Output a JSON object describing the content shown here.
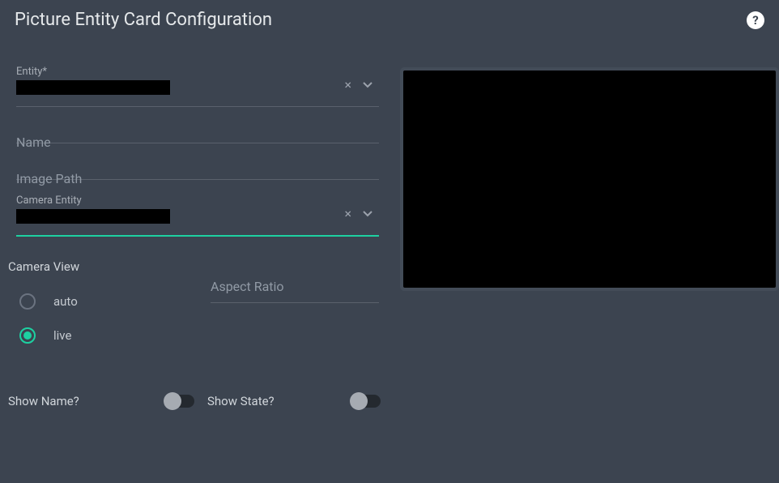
{
  "header": {
    "title": "Picture Entity Card Configuration"
  },
  "form": {
    "entity": {
      "label": "Entity*",
      "value_redacted": true
    },
    "name": {
      "label": "Name",
      "value": ""
    },
    "image_path": {
      "label": "Image Path",
      "value": ""
    },
    "camera_entity": {
      "label": "Camera Entity",
      "value_redacted": true
    }
  },
  "camera_view": {
    "title": "Camera View",
    "options": {
      "auto": "auto",
      "live": "live"
    },
    "selected": "live"
  },
  "aspect_ratio": {
    "label": "Aspect Ratio",
    "value": ""
  },
  "toggles": {
    "show_name": {
      "label": "Show Name?",
      "on": false
    },
    "show_state": {
      "label": "Show State?",
      "on": false
    }
  },
  "icons": {
    "help": "?",
    "clear": "×"
  }
}
